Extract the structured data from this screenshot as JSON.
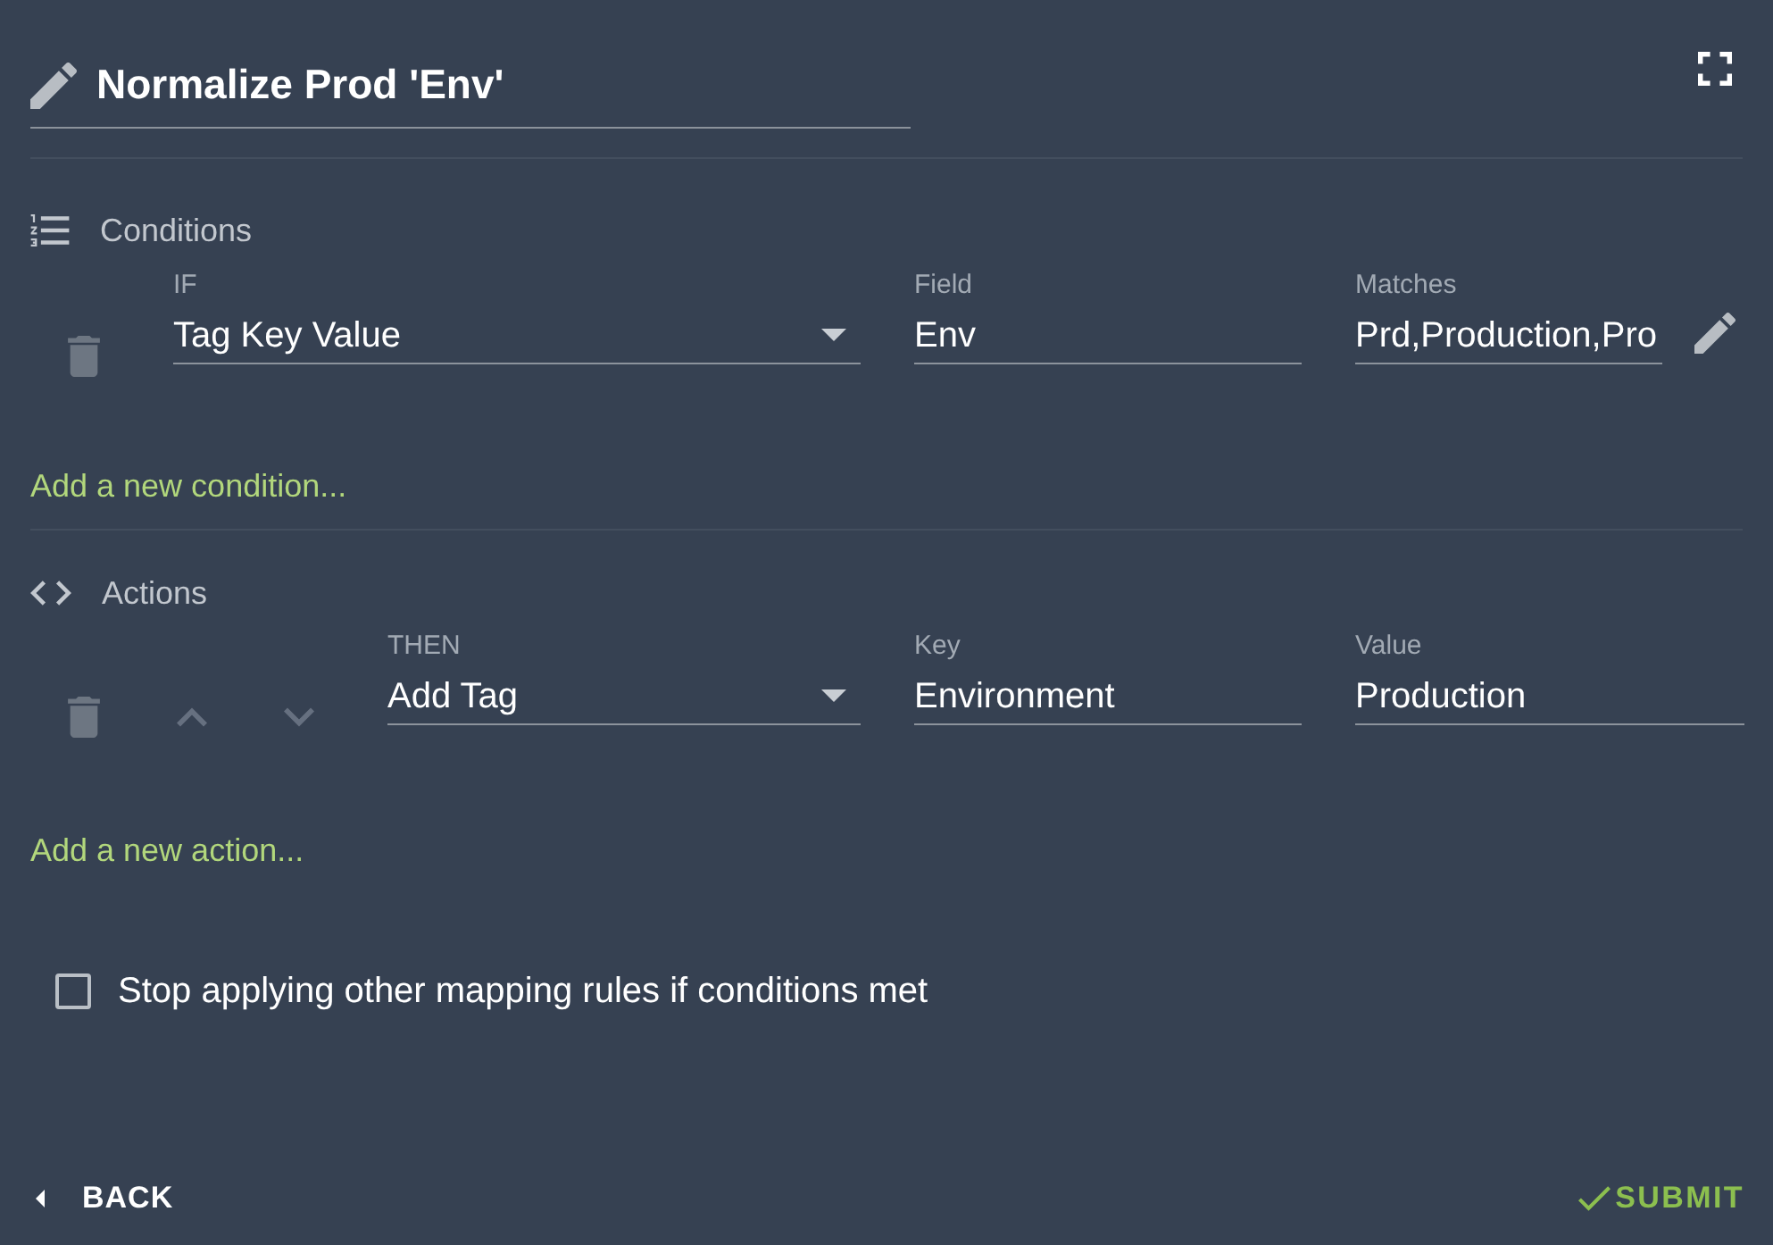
{
  "dialog": {
    "title": "Normalize Prod 'Env'"
  },
  "conditions": {
    "heading": "Conditions",
    "rows": [
      {
        "movable": false,
        "fields": [
          {
            "kind": "select",
            "label": "IF",
            "value": "Tag Key Value"
          },
          {
            "kind": "text",
            "label": "Field",
            "value": "Env"
          },
          {
            "kind": "edit",
            "label": "Matches",
            "value": "Prd,Production,Pro"
          }
        ]
      }
    ],
    "add_link": "Add a new condition..."
  },
  "actions": {
    "heading": "Actions",
    "rows": [
      {
        "movable": true,
        "fields": [
          {
            "kind": "select",
            "label": "THEN",
            "value": "Add Tag"
          },
          {
            "kind": "text",
            "label": "Key",
            "value": "Environment"
          },
          {
            "kind": "text",
            "label": "Value",
            "value": "Production"
          }
        ]
      }
    ],
    "add_link": "Add a new action..."
  },
  "stop_option": {
    "label": "Stop applying other mapping rules if conditions met",
    "checked": false
  },
  "footer": {
    "back": "BACK",
    "submit": "SUBMIT"
  }
}
